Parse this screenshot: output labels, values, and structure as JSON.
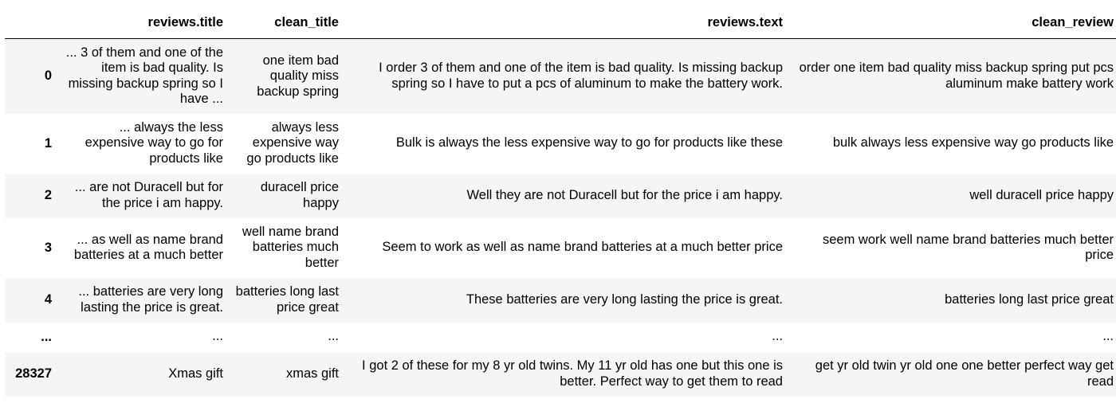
{
  "table": {
    "index_header": "",
    "columns": [
      "reviews.title",
      "clean_title",
      "reviews.text",
      "clean_review"
    ],
    "rows": [
      {
        "index": "0",
        "cells": [
          "... 3 of them and one of the item is bad quality. Is missing backup spring so I have ...",
          "one item bad quality miss backup spring",
          "I order 3 of them and one of the item is bad quality. Is missing backup spring so I have to put a pcs of aluminum to make the battery work.",
          "order one item bad quality miss backup spring put pcs aluminum make battery work"
        ]
      },
      {
        "index": "1",
        "cells": [
          "... always the less expensive way to go for products like",
          "always less expensive way go products like",
          "Bulk is always the less expensive way to go for products like these",
          "bulk always less expensive way go products like"
        ]
      },
      {
        "index": "2",
        "cells": [
          "... are not Duracell but for the price i am happy.",
          "duracell price happy",
          "Well they are not Duracell but for the price i am happy.",
          "well duracell price happy"
        ]
      },
      {
        "index": "3",
        "cells": [
          "... as well as name brand batteries at a much better",
          "well name brand batteries much better",
          "Seem to work as well as name brand batteries at a much better price",
          "seem work well name brand batteries much better price"
        ]
      },
      {
        "index": "4",
        "cells": [
          "... batteries are very long lasting the price is great.",
          "batteries long last price great",
          "These batteries are very long lasting the price is great.",
          "batteries long last price great"
        ]
      },
      {
        "index": "...",
        "cells": [
          "...",
          "...",
          "...",
          "..."
        ]
      },
      {
        "index": "28327",
        "cells": [
          "Xmas gift",
          "xmas gift",
          "I got 2 of these for my 8 yr old twins. My 11 yr old has one but this one is better. Perfect way to get them to read",
          "get yr old twin yr old one one better perfect way get read"
        ]
      }
    ]
  }
}
